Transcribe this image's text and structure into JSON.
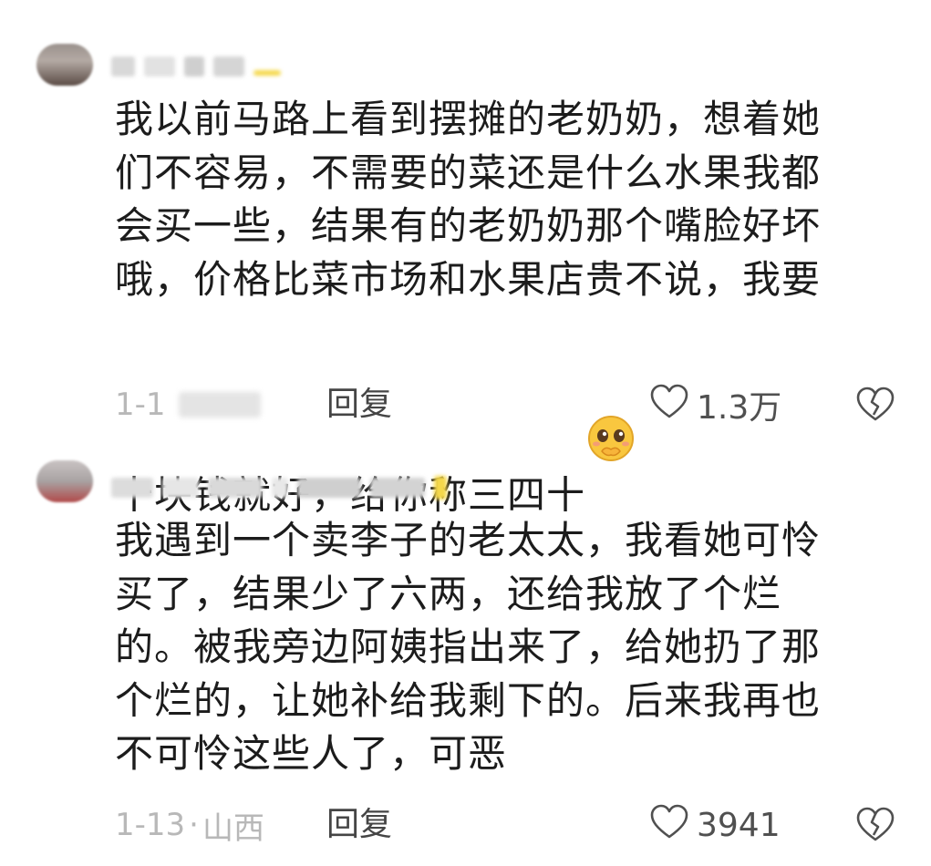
{
  "comments": [
    {
      "text": "我以前马路上看到摆摊的老奶奶，想着她\n们不容易，不需要的菜还是什么水果我都\n会买一些，结果有的老奶奶那个嘴脸好坏\n哦，价格比菜市场和水果店贵不说，我要\n十块钱就好，给你称三四十",
      "emoji": "pleading-face-emoji",
      "date": "1-1",
      "location": "福建",
      "reply_label": "回复",
      "like_count": "1.3万"
    },
    {
      "text": "我遇到一个卖李子的老太太，我看她可怜\n买了，结果少了六两，还给我放了个烂\n的。被我旁边阿姨指出来了，给她扔了那\n个烂的，让她补给我剩下的。后来我再也\n不可怜这些人了，可恶",
      "date": "1-13",
      "location": "山西",
      "reply_label": "回复",
      "like_count": "3941"
    }
  ],
  "icons": {
    "like": "heart-outline-icon",
    "dislike": "broken-heart-outline-icon"
  },
  "colors": {
    "text": "#1c1c1c",
    "meta": "#b8b8b8",
    "action": "#505050"
  }
}
